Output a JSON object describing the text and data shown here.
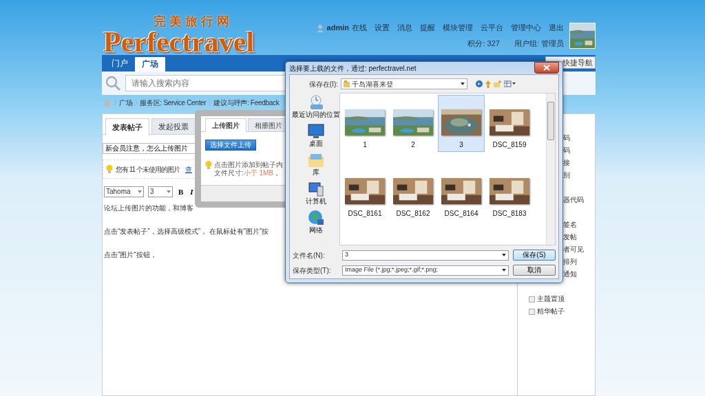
{
  "header": {
    "logo_cn": "完美旅行网",
    "logo": "Perfectravel",
    "user": "admin",
    "user_links": [
      "在线",
      "设置",
      "消息",
      "提醒",
      "模块管理",
      "云平台",
      "管理中心",
      "退出"
    ],
    "credits": "积分: 327",
    "group": "用户组: 管理员"
  },
  "nav": {
    "tabs": [
      {
        "label": "门户",
        "selected": false
      },
      {
        "label": "广场",
        "selected": true
      }
    ],
    "quick_nav": "快捷导航"
  },
  "search": {
    "placeholder": "请输入搜索内容"
  },
  "breadcrumb": [
    "广场",
    "服务区: Service Center",
    "建议与呼声: Feedback"
  ],
  "post_tabs": [
    {
      "label": "发表帖子",
      "selected": true
    },
    {
      "label": "发起投票",
      "selected": false
    }
  ],
  "subject": "新会员注意，怎么上传图片",
  "notice": {
    "text": "您有 11 个未使用的图片",
    "link": "查"
  },
  "editor": {
    "font": "Tahoma",
    "size": "3",
    "tools": [
      "B",
      "I"
    ],
    "paragraphs": [
      "论坛上传图片的功能，和博客",
      "点击“发表帖子”，选择高级模式”， 在鼠标处有”图片”按",
      "点击”图片“按钮，"
    ]
  },
  "upload_popup": {
    "tabs": [
      {
        "label": "上传图片",
        "selected": true
      },
      {
        "label": "相册图片",
        "selected": false
      }
    ],
    "button": "选择文件上传",
    "hint": "点击图片添加到帖子内",
    "size_label": "文件尺寸: ",
    "size_limit": "小于 1MB",
    "size_rest": "，"
  },
  "sidebar": {
    "groups": [
      [
        {
          "kind": "fragment",
          "text": "码"
        },
        {
          "kind": "fragment",
          "text": "码"
        },
        {
          "kind": "fragment",
          "text": "接"
        },
        {
          "kind": "fragment",
          "text": "别"
        }
      ],
      [
        {
          "kind": "fragment",
          "text": "器代码"
        }
      ],
      [
        {
          "kind": "fragment",
          "text": "签名"
        },
        {
          "kind": "fragment",
          "text": "发帖"
        },
        {
          "kind": "fragment",
          "text": "者可见"
        },
        {
          "kind": "fragment",
          "text": "排列"
        },
        {
          "kind": "fragment",
          "text": "通知"
        }
      ],
      [
        {
          "kind": "checkbox",
          "text": "主题置顶",
          "checked": false
        },
        {
          "kind": "checkbox",
          "text": "精华帖子",
          "checked": false
        }
      ]
    ]
  },
  "dialog": {
    "title": "选择要上载的文件，通过: perfectravel.net",
    "location_label": "保存在(I):",
    "location": "千岛湖喜来登",
    "places": [
      {
        "kind": "recent",
        "label": "最近访问的位置"
      },
      {
        "kind": "desktop",
        "label": "桌面"
      },
      {
        "kind": "library",
        "label": "库"
      },
      {
        "kind": "computer",
        "label": "计算机"
      },
      {
        "kind": "network",
        "label": "网络"
      }
    ],
    "files": [
      {
        "name": "1",
        "selected": false
      },
      {
        "name": "2",
        "selected": false
      },
      {
        "name": "3",
        "selected": true
      },
      {
        "name": "DSC_8159",
        "selected": false
      },
      {
        "name": "DSC_8161",
        "selected": false
      },
      {
        "name": "DSC_8162",
        "selected": false
      },
      {
        "name": "DSC_8164",
        "selected": false
      },
      {
        "name": "DSC_8183",
        "selected": false
      }
    ],
    "filename_label": "文件名(N):",
    "filename": "3",
    "type_label": "保存类型(T):",
    "type": "Image File (*.jpg;*.jpeg;*.gif;*.png;",
    "buttons": [
      "保存(S)",
      "取消"
    ]
  }
}
